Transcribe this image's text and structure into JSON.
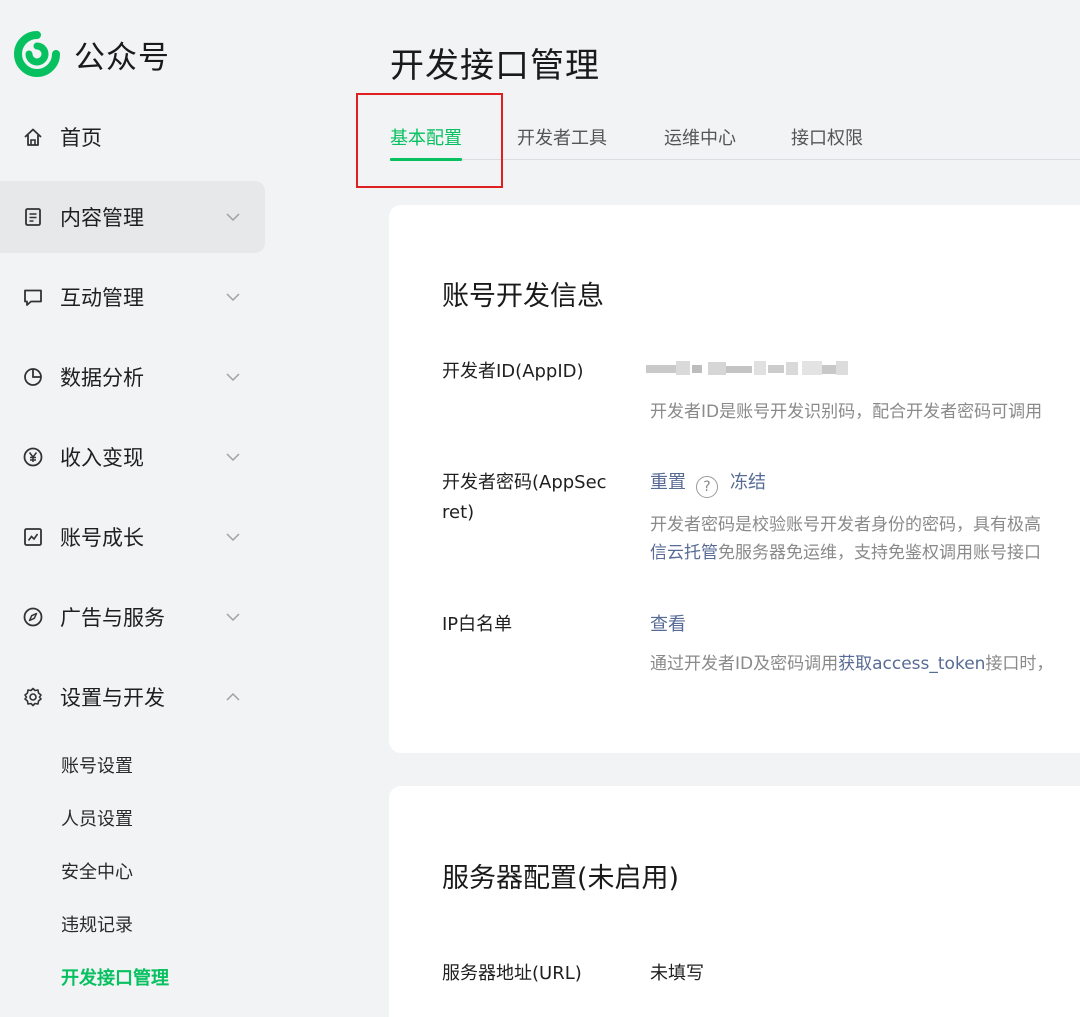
{
  "brand": {
    "name": "公众号"
  },
  "sidebar": {
    "items": [
      {
        "label": "首页",
        "icon": "home-icon"
      },
      {
        "label": "内容管理",
        "icon": "document-icon"
      },
      {
        "label": "互动管理",
        "icon": "chat-icon"
      },
      {
        "label": "数据分析",
        "icon": "pie-chart-icon"
      },
      {
        "label": "收入变现",
        "icon": "yuan-icon"
      },
      {
        "label": "账号成长",
        "icon": "trend-chart-icon"
      },
      {
        "label": "广告与服务",
        "icon": "compass-icon"
      },
      {
        "label": "设置与开发",
        "icon": "gear-icon"
      }
    ],
    "sub_items": [
      "账号设置",
      "人员设置",
      "安全中心",
      "违规记录",
      "开发接口管理"
    ],
    "active_item": "内容管理",
    "current_sub_item": "开发接口管理"
  },
  "page": {
    "title": "开发接口管理"
  },
  "tabs": [
    {
      "label": "基本配置"
    },
    {
      "label": "开发者工具"
    },
    {
      "label": "运维中心"
    },
    {
      "label": "接口权限"
    }
  ],
  "account_dev_info": {
    "title": "账号开发信息",
    "appid": {
      "label": "开发者ID(AppID)",
      "desc": "开发者ID是账号开发识别码，配合开发者密码可调用"
    },
    "appsecret": {
      "label_line1": "开发者密码(AppSec",
      "label_line2": "ret)",
      "reset": "重置",
      "help": "?",
      "freeze": "冻结",
      "desc_line1": "开发者密码是校验账号开发者身份的密码，具有极高",
      "desc_line2_link": "信云托管",
      "desc_line2_rest": "免服务器免运维，支持免鉴权调用账号接口"
    },
    "ip_whitelist": {
      "label": "IP白名单",
      "view": "查看",
      "desc_pre": "通过开发者ID及密码调用",
      "desc_link": "获取access_token",
      "desc_post": "接口时，"
    }
  },
  "server_config": {
    "title": "服务器配置(未启用)",
    "url_label": "服务器地址(URL)",
    "url_value": "未填写"
  },
  "colors": {
    "accent": "#07c160",
    "link": "#576b95",
    "highlight": "#e02020"
  }
}
